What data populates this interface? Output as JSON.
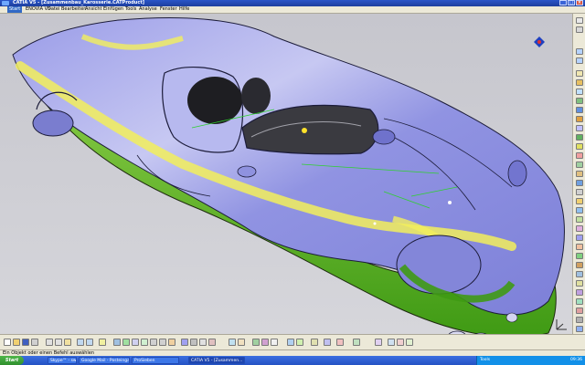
{
  "window": {
    "title": "CATIA V5 - [Zusammenbau_Karosserie.CATProduct]"
  },
  "menu": {
    "items": [
      "Start",
      "ENOVIA V5",
      "Datei",
      "Bearbeiten",
      "Ansicht",
      "Einfügen",
      "Tools",
      "Analyse",
      "Fenster",
      "Hilfe"
    ]
  },
  "status": {
    "message": "Ein Objekt oder einen Befehl auswählen"
  },
  "taskbar": {
    "start_label": "Start",
    "tasks": [
      "Skype™ - switchFi",
      "Google Mail - Posteingan...",
      "ProSieben",
      "CATIA V5 - [Zusammen..."
    ],
    "tray_tools": "Tools",
    "clock": "09:36"
  },
  "colors": {
    "title_bar": "#1d3e9e",
    "car_body_main": "#8c8fe0",
    "car_highlight": "#f2f06a",
    "car_shadow": "#4fa81c",
    "viewport_bg": "#c9c9cf",
    "taskbar": "#2452c4",
    "start_button": "#2f8f2c"
  }
}
